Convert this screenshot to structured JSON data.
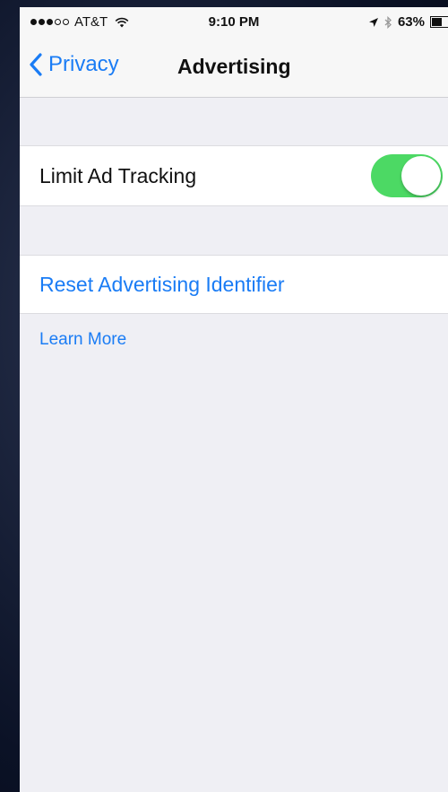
{
  "status_bar": {
    "carrier": "AT&T",
    "time": "9:10 PM",
    "battery_percent": "63%",
    "battery_level": 0.63,
    "signal_bars_filled": 3,
    "signal_bars_total": 5,
    "icons": [
      "signal-dots-icon",
      "wifi-icon",
      "location-arrow-icon",
      "bluetooth-icon",
      "battery-icon"
    ]
  },
  "nav": {
    "back_label": "Privacy",
    "title": "Advertising"
  },
  "settings": {
    "limit_ad_tracking": {
      "label": "Limit Ad Tracking",
      "enabled": true
    },
    "reset_identifier": {
      "label": "Reset Advertising Identifier"
    },
    "learn_more": "Learn More"
  },
  "colors": {
    "accent": "#1a7cf5",
    "toggle_on": "#4cd964",
    "background": "#efeff4"
  }
}
